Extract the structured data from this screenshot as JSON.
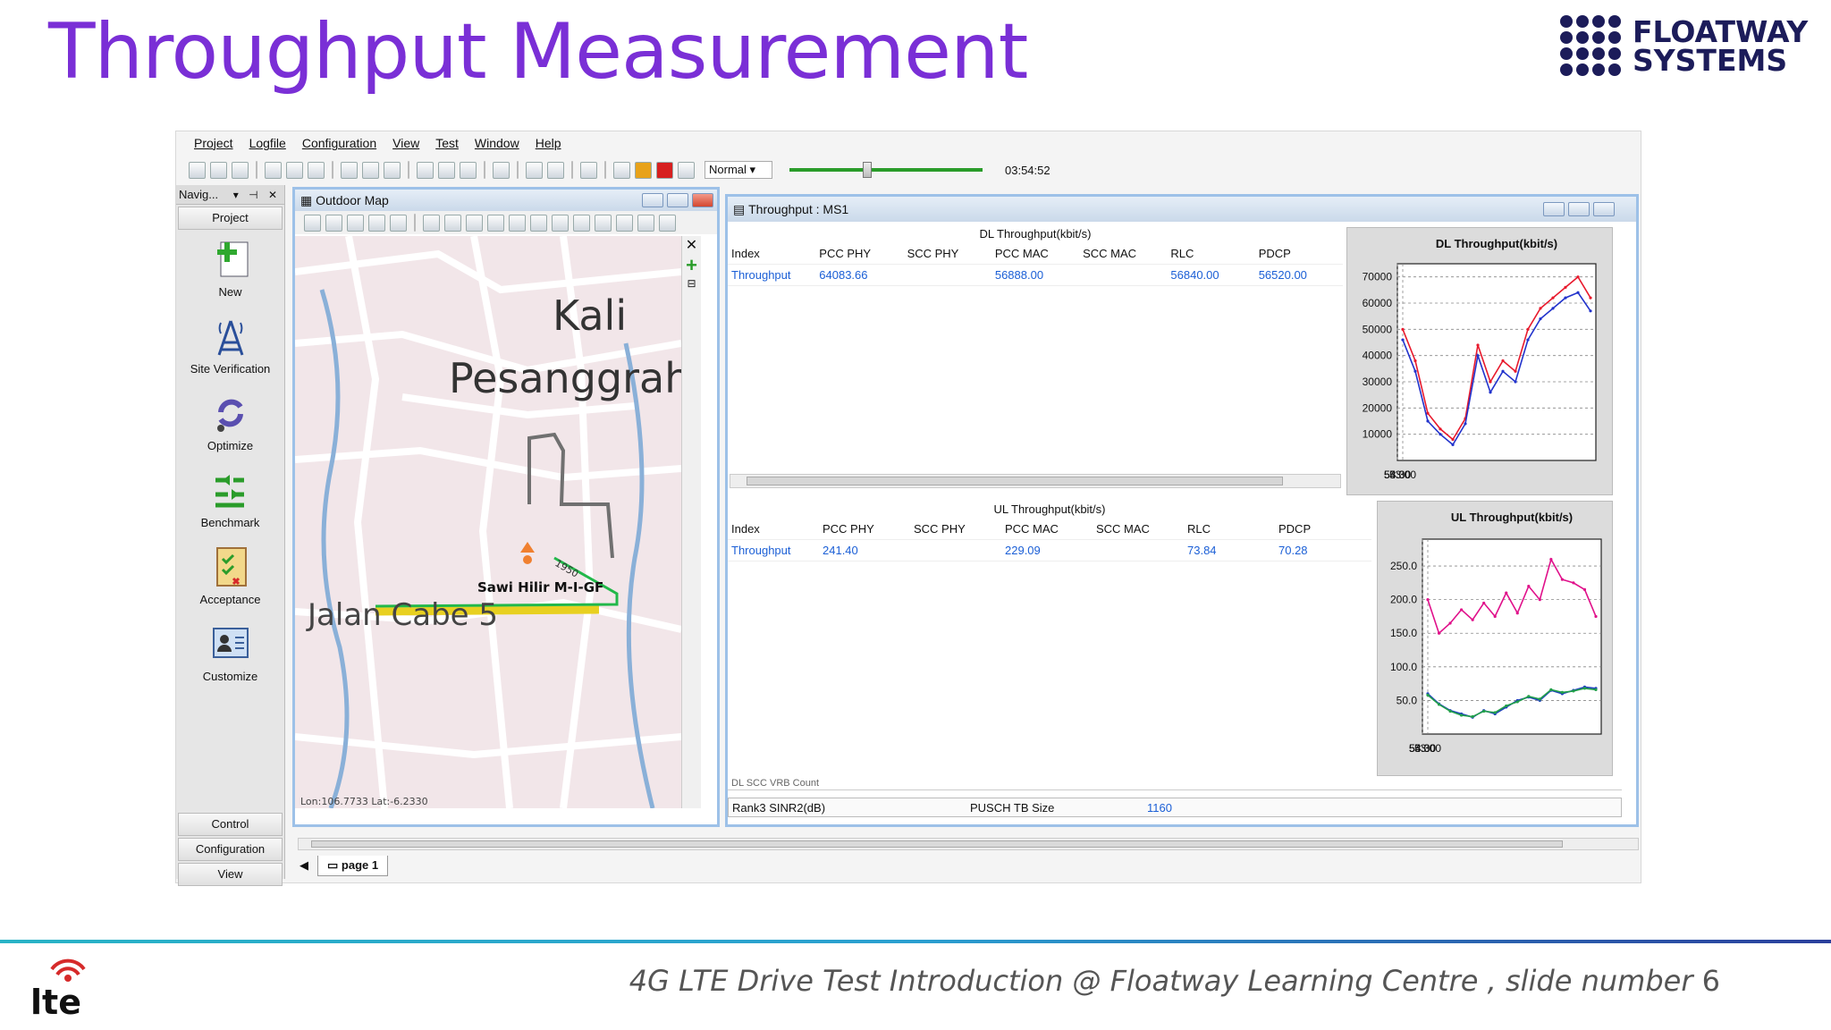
{
  "slide": {
    "title": "Throughput Measurement",
    "brand": {
      "line1": "FLOATWAY",
      "line2": "SYSTEMS"
    },
    "footer": {
      "text": "4G LTE Drive Test Introduction @ Floatway Learning Centre , slide number ",
      "number": "6"
    },
    "logo_text": "lte"
  },
  "app": {
    "menu": [
      "Project",
      "Logfile",
      "Configuration",
      "View",
      "Test",
      "Window",
      "Help"
    ],
    "toolbar": {
      "speed": "Normal",
      "time": "03:54:52",
      "slider_position": 0.4
    },
    "navigator": {
      "title": "Navig...",
      "tab": "Project",
      "items": [
        "New",
        "Site Verification",
        "Optimize",
        "Benchmark",
        "Acceptance",
        "Customize"
      ],
      "bottom_tabs": [
        "Control",
        "Configuration",
        "View"
      ]
    },
    "map": {
      "title": "Outdoor Map",
      "labels": [
        "Kali",
        "Pesanggrah",
        "Jalan Cabe 5",
        "Sawi Hilir M-I-GF",
        "1950"
      ],
      "coords": "Lon:106.7733 Lat:-6.2330",
      "page_tab": "page 1"
    },
    "throughput": {
      "title": "Throughput : MS1",
      "columns": [
        "Index",
        "PCC PHY",
        "SCC PHY",
        "PCC MAC",
        "SCC MAC",
        "RLC",
        "PDCP"
      ],
      "dl": {
        "title": "DL Throughput(kbit/s)",
        "row": [
          "Throughput",
          "64083.66",
          "",
          "56888.00",
          "",
          "56840.00",
          "56520.00"
        ]
      },
      "ul": {
        "title": "UL Throughput(kbit/s)",
        "row": [
          "Throughput",
          "241.40",
          "",
          "229.09",
          "",
          "73.84",
          "70.28"
        ]
      },
      "status": {
        "left_label": "Rank3 SINR2(dB)",
        "right_label": "PUSCH TB Size",
        "right_value": "1160",
        "clipped_label": "DL SCC VRB Count"
      }
    }
  },
  "chart_data": [
    {
      "type": "line",
      "title": "DL Throughput(kbit/s)",
      "x": [
        "53:00",
        "53:07",
        "53:14",
        "53:21",
        "53:28",
        "53:35",
        "53:42",
        "53:49",
        "53:56",
        "54:03",
        "54:10",
        "54:17",
        "54:24",
        "54:31",
        "54:38",
        "54:45"
      ],
      "xticks": [
        "53:00",
        "53:30",
        "54:00",
        "54:30"
      ],
      "yticks": [
        10000,
        20000,
        30000,
        40000,
        50000,
        60000,
        70000
      ],
      "ylim": [
        0,
        75000
      ],
      "grid": true,
      "series": [
        {
          "color": "#e8192c",
          "values": [
            50000,
            38000,
            18000,
            12000,
            8000,
            16000,
            44000,
            30000,
            38000,
            34000,
            50000,
            58000,
            62000,
            66000,
            70000,
            62000
          ]
        },
        {
          "color": "#2233cc",
          "values": [
            46000,
            34000,
            15000,
            10000,
            6000,
            14000,
            40000,
            26000,
            34000,
            30000,
            46000,
            54000,
            58000,
            62000,
            64000,
            57000
          ]
        }
      ]
    },
    {
      "type": "line",
      "title": "UL Throughput(kbit/s)",
      "x": [
        "53:00",
        "53:07",
        "53:14",
        "53:21",
        "53:28",
        "53:35",
        "53:42",
        "53:49",
        "53:56",
        "54:03",
        "54:10",
        "54:17",
        "54:24",
        "54:31",
        "54:38",
        "54:45"
      ],
      "xticks": [
        "53:00",
        "53:30",
        "54:00",
        "54:30"
      ],
      "yticks": [
        50.0,
        100.0,
        150.0,
        200.0,
        250.0
      ],
      "ylim": [
        0,
        290
      ],
      "grid": true,
      "series": [
        {
          "color": "#e0108a",
          "values": [
            200,
            150,
            165,
            185,
            170,
            195,
            175,
            210,
            180,
            220,
            200,
            260,
            230,
            225,
            215,
            175
          ]
        },
        {
          "color": "#1f3fbf",
          "values": [
            60,
            45,
            35,
            30,
            25,
            35,
            30,
            40,
            50,
            55,
            50,
            65,
            60,
            65,
            70,
            68
          ]
        },
        {
          "color": "#22a04a",
          "values": [
            58,
            44,
            34,
            28,
            26,
            34,
            32,
            42,
            48,
            56,
            52,
            66,
            62,
            64,
            68,
            66
          ]
        }
      ]
    }
  ]
}
